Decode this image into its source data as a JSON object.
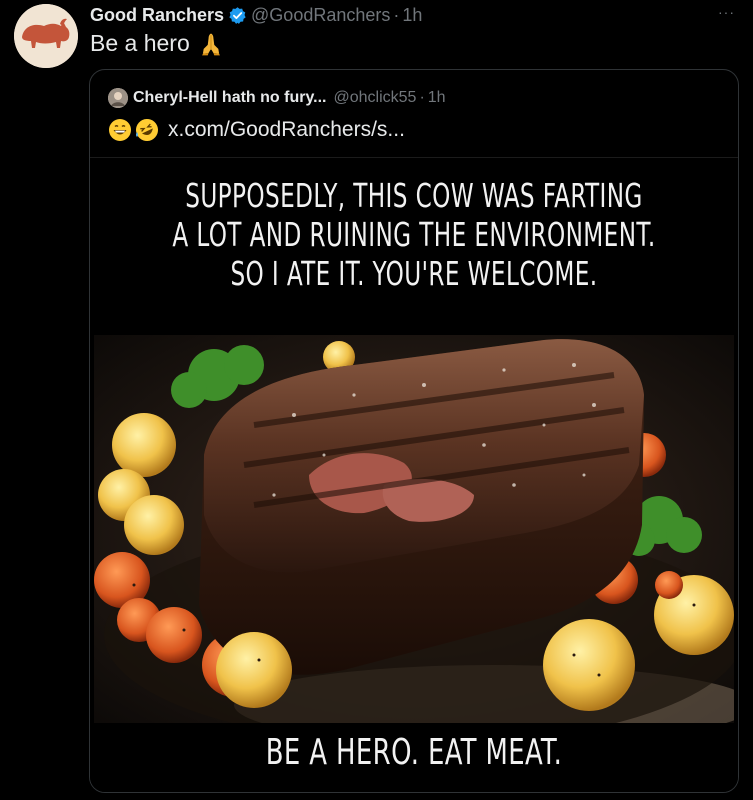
{
  "tweet": {
    "display_name": "Good Ranchers",
    "handle": "@GoodRanchers",
    "separator": "·",
    "time": "1h",
    "more_label": "···",
    "text": "Be a hero",
    "text_emoji": "folded-hands-emoji"
  },
  "quote": {
    "display_name": "Cheryl-Hell hath no fury...",
    "handle": "@ohclick55",
    "separator": "·",
    "time": "1h",
    "emojis": [
      "grinning-emoji",
      "rolling-laughing-emoji"
    ],
    "link": "x.com/GoodRanchers/s..."
  },
  "meme": {
    "caption_top": [
      "SUPPOSEDLY, THIS COW WAS FARTING",
      "A LOT AND RUINING THE ENVIRONMENT.",
      "SO I ATE IT. YOU'RE WELCOME."
    ],
    "caption_bottom": "BE A HERO. EAT MEAT.",
    "image": "grilled-steak-photo"
  },
  "colors": {
    "background": "#000000",
    "text": "#e7e9ea",
    "secondary": "#71767b",
    "verified": "#1d9bf0",
    "brand_avatar": "#c85a3c"
  }
}
